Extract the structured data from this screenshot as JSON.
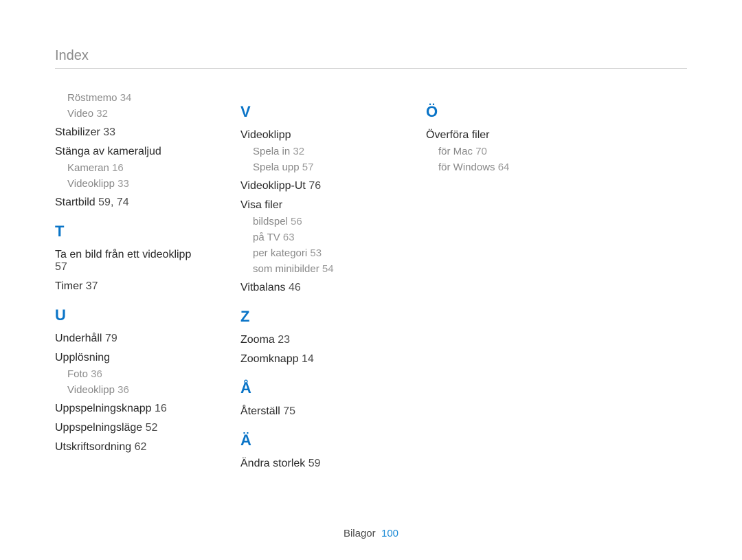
{
  "page_title": "Index",
  "footer": {
    "section": "Bilagor",
    "page_number": "100"
  },
  "cols": [
    {
      "groups": [
        {
          "letter": null,
          "entries": [
            {
              "isSub": true,
              "label": "Röstmemo",
              "pages": "34"
            },
            {
              "isSub": true,
              "label": "Video",
              "pages": "32"
            },
            {
              "isSub": false,
              "label": "Stabilizer",
              "pages": "33"
            },
            {
              "isSub": false,
              "label": "Stänga av kameraljud",
              "pages": ""
            },
            {
              "isSub": true,
              "label": "Kameran",
              "pages": "16"
            },
            {
              "isSub": true,
              "label": "Videoklipp",
              "pages": "33"
            },
            {
              "isSub": false,
              "label": "Startbild",
              "pages": "59, 74"
            }
          ]
        },
        {
          "letter": "T",
          "entries": [
            {
              "isSub": false,
              "label": "Ta en bild från ett videoklipp",
              "pages": "57"
            },
            {
              "isSub": false,
              "label": "Timer",
              "pages": "37"
            }
          ]
        },
        {
          "letter": "U",
          "entries": [
            {
              "isSub": false,
              "label": "Underhåll",
              "pages": "79"
            },
            {
              "isSub": false,
              "label": "Upplösning",
              "pages": ""
            },
            {
              "isSub": true,
              "label": "Foto",
              "pages": "36"
            },
            {
              "isSub": true,
              "label": "Videoklipp",
              "pages": "36"
            },
            {
              "isSub": false,
              "label": "Uppspelningsknapp",
              "pages": "16"
            },
            {
              "isSub": false,
              "label": "Uppspelningsläge",
              "pages": "52"
            },
            {
              "isSub": false,
              "label": "Utskriftsordning",
              "pages": "62"
            }
          ]
        }
      ]
    },
    {
      "groups": [
        {
          "letter": "V",
          "entries": [
            {
              "isSub": false,
              "label": "Videoklipp",
              "pages": ""
            },
            {
              "isSub": true,
              "label": "Spela in",
              "pages": "32"
            },
            {
              "isSub": true,
              "label": "Spela upp",
              "pages": "57"
            },
            {
              "isSub": false,
              "label": "Videoklipp-Ut",
              "pages": "76"
            },
            {
              "isSub": false,
              "label": "Visa filer",
              "pages": ""
            },
            {
              "isSub": true,
              "label": "bildspel",
              "pages": "56"
            },
            {
              "isSub": true,
              "label": "på TV",
              "pages": "63"
            },
            {
              "isSub": true,
              "label": "per kategori",
              "pages": "53"
            },
            {
              "isSub": true,
              "label": "som minibilder",
              "pages": "54"
            },
            {
              "isSub": false,
              "label": "Vitbalans",
              "pages": "46"
            }
          ]
        },
        {
          "letter": "Z",
          "entries": [
            {
              "isSub": false,
              "label": "Zooma",
              "pages": "23"
            },
            {
              "isSub": false,
              "label": "Zoomknapp",
              "pages": "14"
            }
          ]
        },
        {
          "letter": "Å",
          "entries": [
            {
              "isSub": false,
              "label": "Återställ",
              "pages": "75"
            }
          ]
        },
        {
          "letter": "Ä",
          "entries": [
            {
              "isSub": false,
              "label": "Ändra storlek",
              "pages": "59"
            }
          ]
        }
      ]
    },
    {
      "groups": [
        {
          "letter": "Ö",
          "entries": [
            {
              "isSub": false,
              "label": "Överföra filer",
              "pages": ""
            },
            {
              "isSub": true,
              "label": "för Mac",
              "pages": "70"
            },
            {
              "isSub": true,
              "label": "för Windows",
              "pages": "64"
            }
          ]
        }
      ]
    }
  ]
}
